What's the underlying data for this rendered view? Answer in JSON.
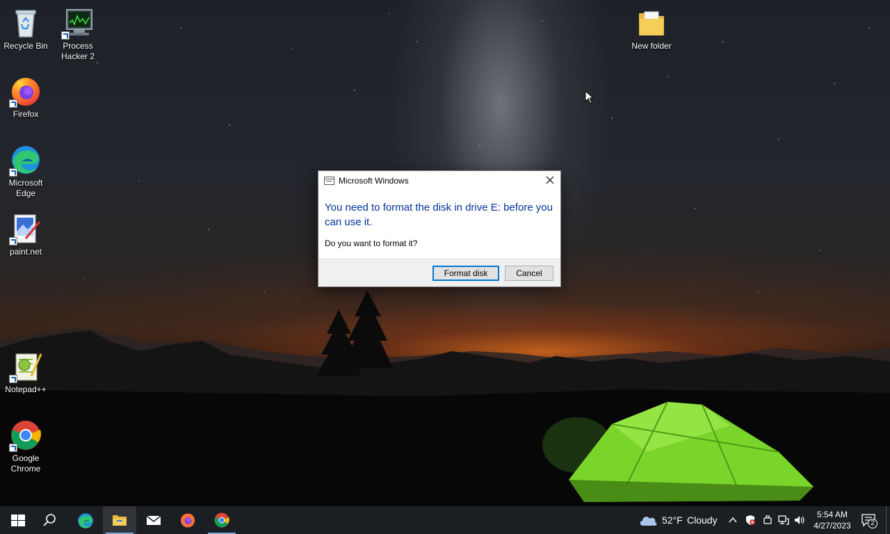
{
  "desktop": {
    "icons": [
      {
        "label": "Recycle Bin",
        "icon": "recycle-bin-icon"
      },
      {
        "label": "Process Hacker 2",
        "icon": "process-hacker-icon"
      },
      {
        "label": "Firefox",
        "icon": "firefox-icon"
      },
      {
        "label": "Microsoft Edge",
        "icon": "edge-icon"
      },
      {
        "label": "paint.net",
        "icon": "paintnet-icon"
      },
      {
        "label": "Notepad++",
        "icon": "notepadpp-icon"
      },
      {
        "label": "Google Chrome",
        "icon": "chrome-icon"
      },
      {
        "label": "New folder",
        "icon": "folder-icon"
      }
    ]
  },
  "dialog": {
    "title": "Microsoft Windows",
    "main_instruction": "You need to format the disk in drive E: before you can use it.",
    "content": "Do you want to format it?",
    "primary_button": "Format disk",
    "secondary_button": "Cancel"
  },
  "taskbar": {
    "pinned": [
      "start-icon",
      "search-icon",
      "edge-icon",
      "file-explorer-icon",
      "mail-icon",
      "firefox-icon",
      "chrome-icon"
    ],
    "weather": {
      "temp": "52°F",
      "condition": "Cloudy"
    },
    "clock": {
      "time": "5:54 AM",
      "date": "4/27/2023"
    },
    "notifications_count": "2"
  },
  "colors": {
    "dialog_instruction": "#003399",
    "default_button_border": "#0078d7",
    "taskbar": "#1b1e23"
  }
}
